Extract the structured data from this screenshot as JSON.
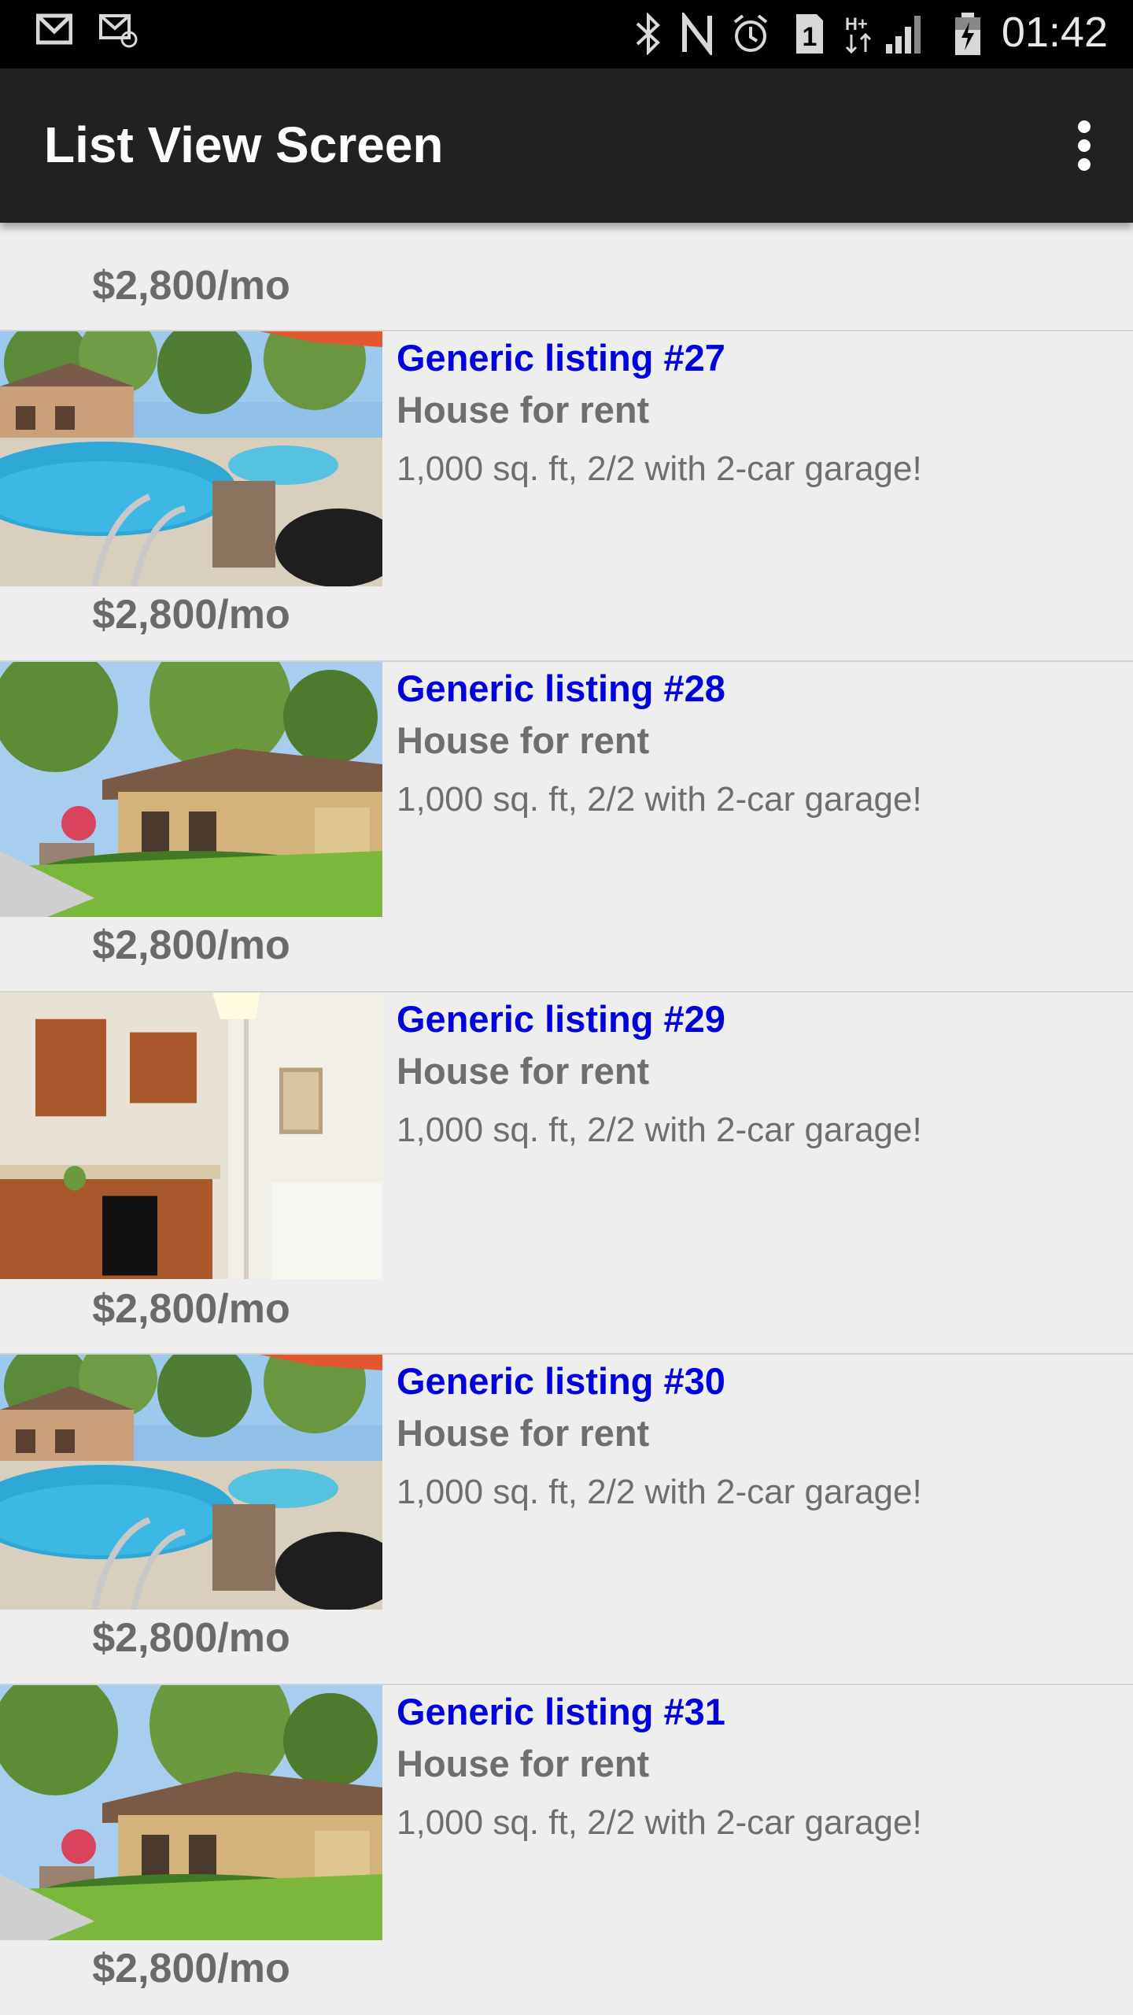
{
  "status_bar": {
    "time": "01:42",
    "icons": [
      "gmail-icon",
      "email-icon",
      "bluetooth-icon",
      "nfc-icon",
      "alarm-icon",
      "sim-1-icon",
      "hplus-data-icon",
      "signal-icon",
      "battery-charging-icon"
    ]
  },
  "app_bar": {
    "title": "List View Screen",
    "menu_icon": "overflow-menu-icon"
  },
  "partial_item": {
    "price": "$2,800/mo"
  },
  "listings": [
    {
      "title": "Generic listing #27",
      "type": "House for rent",
      "description": "1,000 sq. ft, 2/2 with 2-car garage!",
      "price": "$2,800/mo",
      "image": "pool"
    },
    {
      "title": "Generic listing #28",
      "type": "House for rent",
      "description": "1,000 sq. ft, 2/2 with 2-car garage!",
      "price": "$2,800/mo",
      "image": "house"
    },
    {
      "title": "Generic listing #29",
      "type": "House for rent",
      "description": "1,000 sq. ft, 2/2 with 2-car garage!",
      "price": "$2,800/mo",
      "image": "kitchen"
    },
    {
      "title": "Generic listing #30",
      "type": "House for rent",
      "description": "1,000 sq. ft, 2/2 with 2-car garage!",
      "price": "$2,800/mo",
      "image": "pool"
    },
    {
      "title": "Generic listing #31",
      "type": "House for rent",
      "description": "1,000 sq. ft, 2/2 with 2-car garage!",
      "price": "$2,800/mo",
      "image": "house"
    }
  ]
}
